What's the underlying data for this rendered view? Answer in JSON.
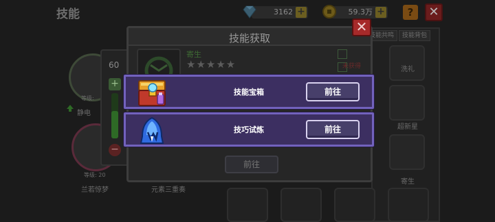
{
  "header": {
    "title": "技能",
    "gems": "3162",
    "coins": "59.3万",
    "help": "?",
    "close": "✕"
  },
  "background": {
    "slider_value": "60",
    "slider_level": 0.6,
    "left_skills": [
      {
        "label": "静电",
        "level": "等级:"
      },
      {
        "label": "兰若惊梦",
        "level": "等级: 20"
      }
    ],
    "center_label": "元素三重奏",
    "right_tabs": [
      "技能共鸣",
      "技能背包"
    ],
    "right_labels": [
      "洗礼",
      "超新星",
      "寄生"
    ]
  },
  "modal": {
    "title": "技能获取",
    "close": "✕",
    "skill": {
      "name": "寄生",
      "stars": "★★★★★",
      "status": "未获得"
    },
    "options": [
      {
        "label": "技能宝箱",
        "button": "前往",
        "icon": "treasure-chest-icon"
      },
      {
        "label": "技巧试炼",
        "button": "前往",
        "icon": "blue-hood-icon"
      }
    ],
    "bottom_button": "前往"
  }
}
